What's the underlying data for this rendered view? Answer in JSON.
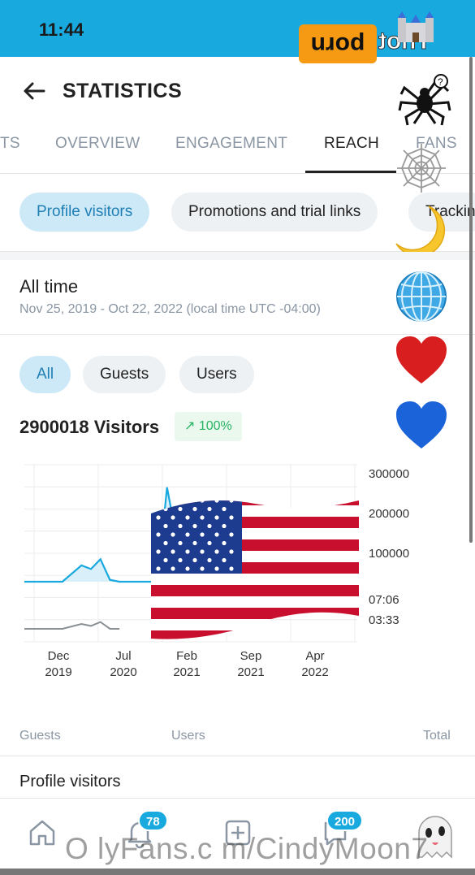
{
  "status": {
    "time": "11:44"
  },
  "overlay": {
    "thot_logo": [
      "Thot",
      "porn"
    ],
    "flag": "us-flag"
  },
  "header": {
    "title": "STATISTICS",
    "back_icon": "arrow-left-icon"
  },
  "tabs": [
    {
      "label": "TS"
    },
    {
      "label": "OVERVIEW"
    },
    {
      "label": "ENGAGEMENT"
    },
    {
      "label": "REACH",
      "active": true
    },
    {
      "label": "FANS"
    }
  ],
  "chips": [
    {
      "label": "Profile visitors",
      "active": true
    },
    {
      "label": "Promotions and trial links"
    },
    {
      "label": "Tracking"
    }
  ],
  "period": {
    "title": "All time",
    "range": "Nov 25, 2019 - Oct 22, 2022 (local time UTC -04:00)"
  },
  "filters": [
    {
      "label": "All",
      "active": true
    },
    {
      "label": "Guests"
    },
    {
      "label": "Users"
    }
  ],
  "visitors": {
    "summary": "2900018 Visitors",
    "growth": "100%",
    "growth_color": "#28b463"
  },
  "chart_data": {
    "type": "line",
    "y_ticks_visitors": [
      "300000",
      "200000",
      "100000"
    ],
    "y_ticks_duration": [
      "07:06",
      "03:33"
    ],
    "x_ticks": [
      {
        "month": "Dec",
        "year": "2019"
      },
      {
        "month": "Jul",
        "year": "2020"
      },
      {
        "month": "Feb",
        "year": "2021"
      },
      {
        "month": "Sep",
        "year": "2021"
      },
      {
        "month": "Apr",
        "year": "2022"
      }
    ],
    "series": [
      {
        "color": "#18a9df",
        "x": [
          "Nov 2019",
          "Jan 2020",
          "Mar 2020",
          "May 2020",
          "Jun 2020",
          "Jul 2020",
          "Aug 2020",
          "Sep 2020",
          "Nov 2020",
          "Jan 2021",
          "Feb 2021",
          "Mar 2021",
          "Apr 2021",
          "May 2021",
          "Jun 2021"
        ],
        "values": [
          0,
          0,
          0,
          45000,
          35000,
          62000,
          5000,
          0,
          0,
          0,
          260000,
          120000,
          150000,
          140000,
          160000
        ]
      },
      {
        "color": "#8a8f94",
        "x": [
          "Nov 2019",
          "Jan 2020",
          "Mar 2020",
          "May 2020",
          "Jun 2020",
          "Jul 2020",
          "Aug 2020",
          "Sep 2020"
        ],
        "values": [
          0,
          0,
          0,
          10,
          6,
          14,
          0,
          0
        ]
      }
    ],
    "accent": "#18a9df"
  },
  "table": {
    "col_guests": "Guests",
    "col_users": "Users",
    "col_total": "Total",
    "row_label": "Profile visitors"
  },
  "nav": {
    "notifications_badge": "78",
    "messages_badge": "200"
  },
  "watermark": "O lyFans.c m/CindyMoon7"
}
